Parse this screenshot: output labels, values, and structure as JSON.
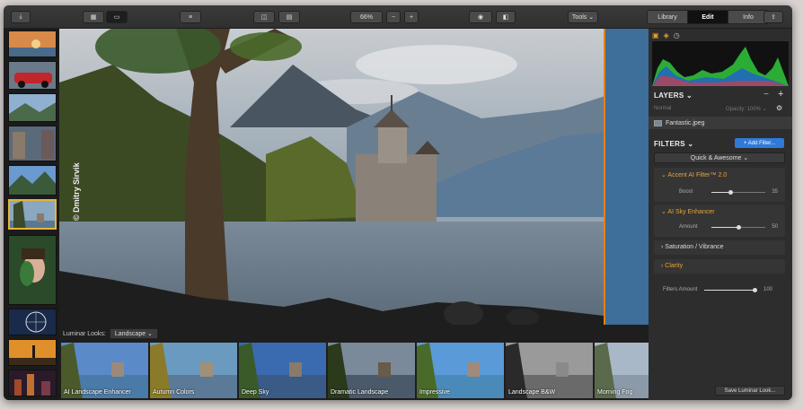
{
  "toolbar": {
    "zoom": "66%",
    "zoom_out": "−",
    "zoom_in": "+",
    "tools_label": "Tools ⌄",
    "tabs": [
      {
        "label": "Library",
        "active": false
      },
      {
        "label": "Edit",
        "active": true
      },
      {
        "label": "Info",
        "active": false
      }
    ],
    "icons": [
      "import-icon",
      "grid-icon",
      "single-view-icon",
      "sort-icon",
      "sidebar-icon",
      "compare-icon",
      "eye-icon",
      "split-icon",
      "share-icon"
    ]
  },
  "canvas": {
    "watermark": "© Dmitry Sirvik"
  },
  "looks": {
    "label": "Luminar Looks:",
    "category": "Landscape ⌄",
    "items": [
      {
        "label": "AI Landscape Enhancer"
      },
      {
        "label": "Autumn Colors"
      },
      {
        "label": "Deep Sky"
      },
      {
        "label": "Dramatic Landscape"
      },
      {
        "label": "Impressive"
      },
      {
        "label": "Landscape B&W"
      },
      {
        "label": "Morning Fog"
      }
    ]
  },
  "panel": {
    "layers_title": "LAYERS ⌄",
    "layer_blend": "Normal",
    "layer_opacity": "Opacity: 100% ⌄",
    "layer_name": "Fantastic.jpeg",
    "filters_title": "FILTERS ⌄",
    "add_filter": "+ Add Filter...",
    "preset": "Quick & Awesome ⌄",
    "filters": [
      {
        "title": "⌄  Accent AI Filter™ 2.0",
        "slider": {
          "label": "Boost",
          "value": "35",
          "fraction": 0.35
        }
      },
      {
        "title": "⌄  AI Sky Enhancer",
        "slider": {
          "label": "Amount",
          "value": "50",
          "fraction": 0.5
        }
      },
      {
        "title": "›  Saturation / Vibrance"
      },
      {
        "title": "›  Clarity"
      }
    ],
    "filters_amount": {
      "label": "Filters Amount",
      "value": "100",
      "fraction": 1.0
    },
    "save_looks": "Save Luminar Look..."
  },
  "colors": {
    "accent": "#e8a33a",
    "button_blue": "#2f7ad9",
    "selection": "#e5b53a"
  }
}
